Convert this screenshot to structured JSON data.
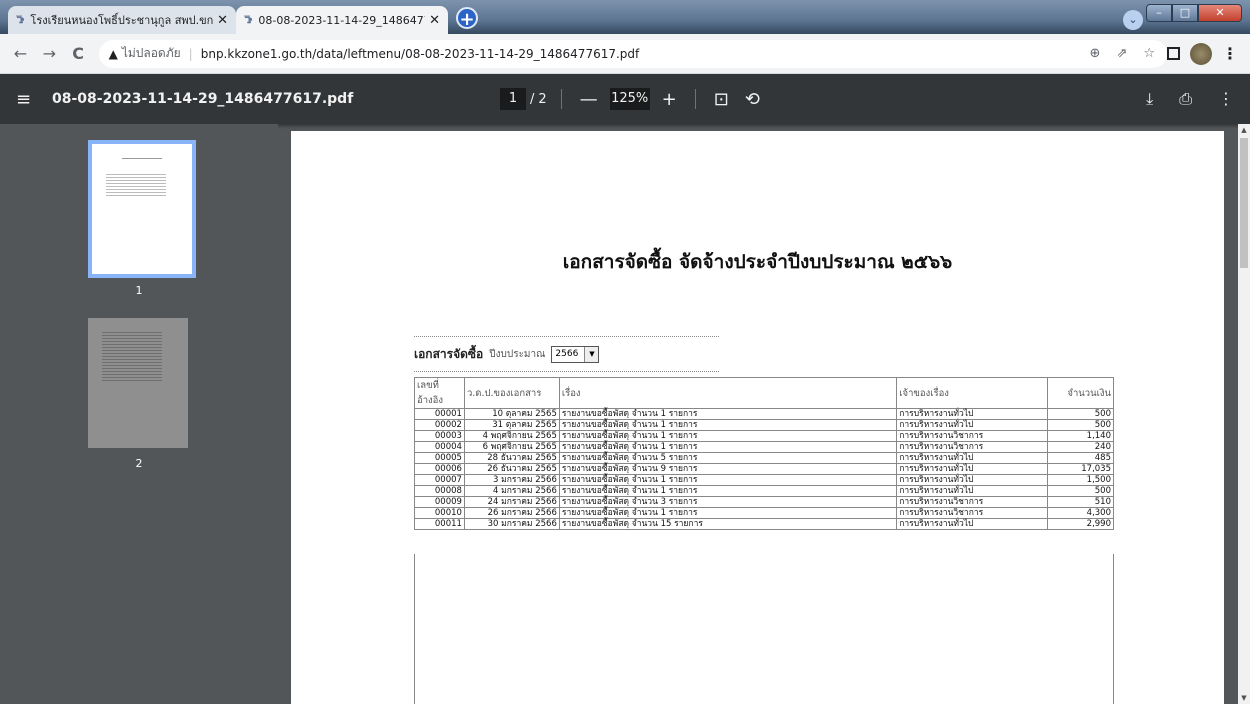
{
  "browser": {
    "tabs": [
      {
        "favicon": "ꔥ",
        "title": "โรงเรียนหนองโพธิ์ประชานุกูล สพป.ขก.",
        "close": "✕"
      },
      {
        "favicon": "ꔥ",
        "title": "08-08-2023-11-14-29_14864776",
        "close": "✕"
      }
    ],
    "new_tab": "+",
    "window_buttons": {
      "minimize": "–",
      "maximize": "□",
      "close": "✕"
    },
    "profile_menu": "⌄",
    "nav": {
      "back": "←",
      "forward": "→",
      "reload": "C"
    },
    "address": {
      "warning_icon": "▲",
      "security_text": "ไม่ปลอดภัย",
      "separator": "|",
      "url": "bnp.kkzone1.go.th/data/leftmenu/08-08-2023-11-14-29_1486477617.pdf",
      "zoom_icon": "⊕",
      "share_icon": "⇗",
      "star_icon": "☆"
    },
    "menu_dots": "⋮"
  },
  "pdf_viewer": {
    "menu_icon": "≡",
    "file_name": "08-08-2023-11-14-29_1486477617.pdf",
    "current_page": "1",
    "page_separator": "/",
    "total_pages": "2",
    "zoom_out": "—",
    "zoom": "125%",
    "zoom_in": "+",
    "fit_icon": "⊡",
    "rotate_icon": "⟲",
    "download_icon": "⤓",
    "print_icon": "⎙",
    "more_icon": "⋮",
    "thumbnails": [
      {
        "label": "1"
      },
      {
        "label": "2"
      }
    ]
  },
  "document": {
    "title": "เอกสารจัดซื้อ จัดจ้างประจำปีงบประมาณ ๒๕๖๖",
    "filter_label": "เอกสารจัดซื้อ",
    "year_label": "ปีงบประมาณ",
    "year_value": "2566",
    "dropdown_arrow": "▼",
    "table": {
      "headers": [
        "เลขที่อ้างอิง",
        "ว.ด.ป.ของเอกสาร",
        "เรื่อง",
        "เจ้าของเรื่อง",
        "จำนวนเงิน"
      ],
      "rows": [
        [
          "00001",
          "10 ตุลาคม 2565",
          "รายงานขอซื้อพัสดุ  จำนวน  1  รายการ",
          "การบริหารงานทั่วไป",
          "500"
        ],
        [
          "00002",
          "31 ตุลาคม 2565",
          "รายงานขอซื้อพัสดุ  จำนวน  1  รายการ",
          "การบริหารงานทั่วไป",
          "500"
        ],
        [
          "00003",
          "4 พฤศจิกายน 2565",
          "รายงานขอซื้อพัสดุ  จำนวน  1  รายการ",
          "การบริหารงานวิชาการ",
          "1,140"
        ],
        [
          "00004",
          "6 พฤศจิกายน 2565",
          "รายงานขอซื้อพัสดุ  จำนวน  1  รายการ",
          "การบริหารงานวิชาการ",
          "240"
        ],
        [
          "00005",
          "28 ธันวาคม 2565",
          "รายงานขอซื้อพัสดุ  จำนวน  5  รายการ",
          "การบริหารงานทั่วไป",
          "485"
        ],
        [
          "00006",
          "26 ธันวาคม 2565",
          "รายงานขอซื้อพัสดุ  จำนวน  9  รายการ",
          "การบริหารงานทั่วไป",
          "17,035"
        ],
        [
          "00007",
          "3 มกราคม 2566",
          "รายงานขอซื้อพัสดุ  จำนวน  1  รายการ",
          "การบริหารงานทั่วไป",
          "1,500"
        ],
        [
          "00008",
          "4 มกราคม 2566",
          "รายงานขอซื้อพัสดุ  จำนวน  1  รายการ",
          "การบริหารงานทั่วไป",
          "500"
        ],
        [
          "00009",
          "24 มกราคม 2566",
          "รายงานขอซื้อพัสดุ  จำนวน  3  รายการ",
          "การบริหารงานวิชาการ",
          "510"
        ],
        [
          "00010",
          "26 มกราคม 2566",
          "รายงานขอซื้อพัสดุ  จำนวน  1  รายการ",
          "การบริหารงานวิชาการ",
          "4,300"
        ],
        [
          "00011",
          "30 มกราคม 2566",
          "รายงานขอซื้อพัสดุ  จำนวน  15  รายการ",
          "การบริหารงานทั่วไป",
          "2,990"
        ]
      ]
    }
  }
}
